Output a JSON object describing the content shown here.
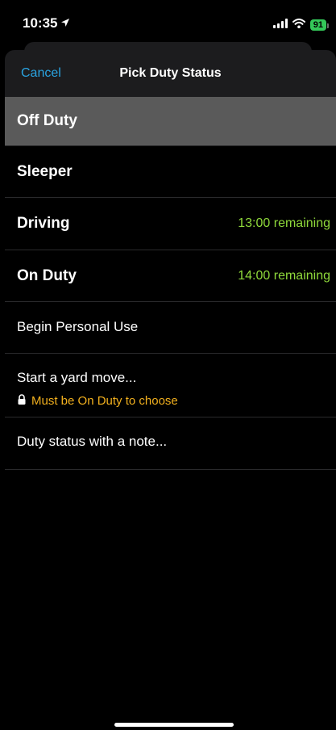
{
  "status_bar": {
    "time": "10:35",
    "battery": "91",
    "battery_color": "#34c759"
  },
  "nav": {
    "cancel_label": "Cancel",
    "title": "Pick Duty Status"
  },
  "rows": [
    {
      "label": "Off Duty",
      "selected": true
    },
    {
      "label": "Sleeper"
    },
    {
      "label": "Driving",
      "remaining": "13:00 remaining"
    },
    {
      "label": "On Duty",
      "remaining": "14:00 remaining"
    },
    {
      "label": "Begin Personal Use"
    },
    {
      "label": "Start a yard move...",
      "note": "Must be On Duty to choose"
    },
    {
      "label": "Duty status with a note..."
    }
  ],
  "colors": {
    "accent": "#2aa4e2",
    "remaining": "#8fd93b",
    "warning": "#f2b01e",
    "selected_bg": "#5a5a5a"
  },
  "icons": [
    "location-arrow-icon",
    "signal-icon",
    "wifi-icon",
    "battery-icon",
    "lock-icon"
  ]
}
